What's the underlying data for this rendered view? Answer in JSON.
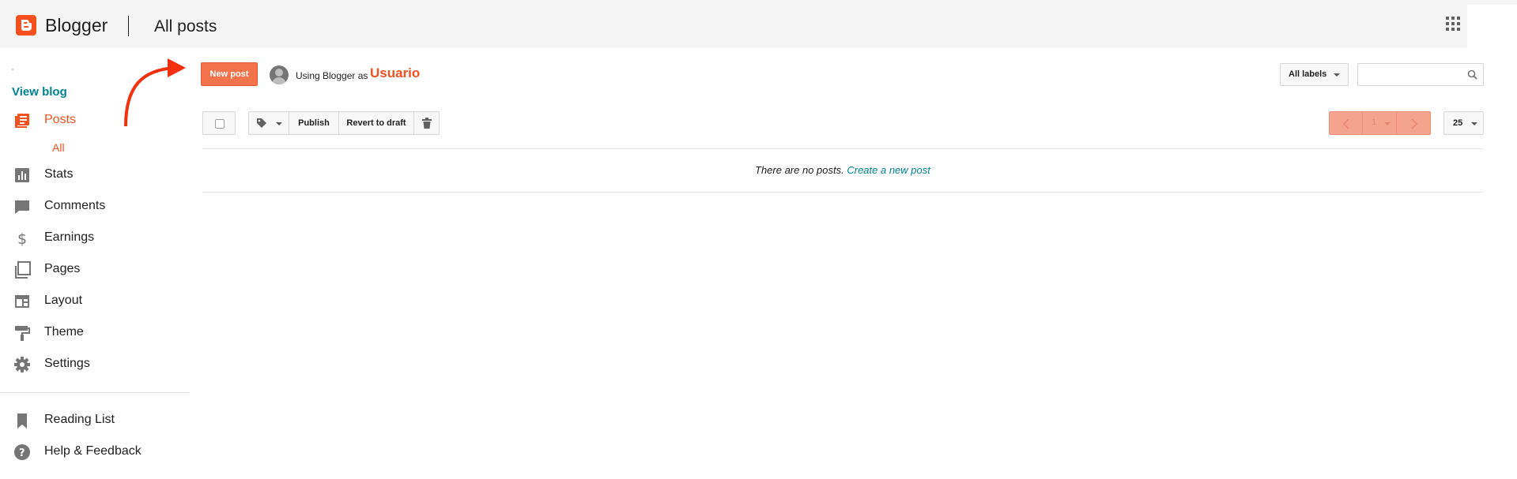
{
  "header": {
    "app_name": "Blogger",
    "page_title": "All posts"
  },
  "sidebar": {
    "view_blog": "View blog",
    "items": [
      {
        "label": "Posts",
        "icon": "posts-icon",
        "active": true
      },
      {
        "label": "Stats",
        "icon": "stats-icon"
      },
      {
        "label": "Comments",
        "icon": "comments-icon"
      },
      {
        "label": "Earnings",
        "icon": "dollar-icon"
      },
      {
        "label": "Pages",
        "icon": "pages-icon"
      },
      {
        "label": "Layout",
        "icon": "layout-icon"
      },
      {
        "label": "Theme",
        "icon": "paint-roller-icon"
      },
      {
        "label": "Settings",
        "icon": "gear-icon"
      },
      {
        "label": "Reading List",
        "icon": "bookmark-icon"
      },
      {
        "label": "Help & Feedback",
        "icon": "help-icon"
      }
    ],
    "posts_sub": "All"
  },
  "main": {
    "new_post": "New post",
    "using_as": "Using Blogger as",
    "username": "Usuario",
    "all_labels": "All labels",
    "search": {
      "placeholder": ""
    },
    "toolbar": {
      "publish": "Publish",
      "revert": "Revert to draft"
    },
    "pager": {
      "page": "1",
      "per_page": "25"
    },
    "empty_text": "There are no posts.",
    "empty_link": "Create a new post"
  },
  "colors": {
    "accent": "#f4511e",
    "link": "#00838f",
    "header_bg": "#f5f5f5"
  }
}
